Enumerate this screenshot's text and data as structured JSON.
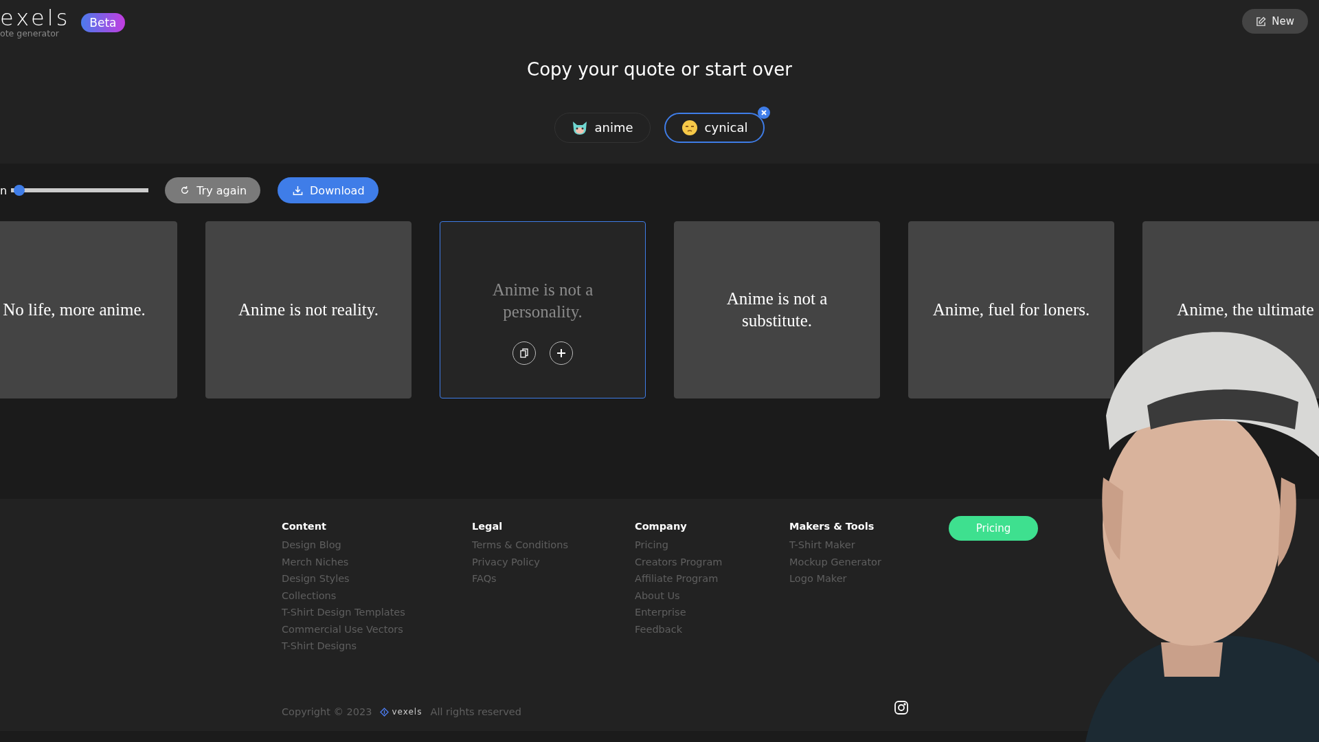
{
  "brand": {
    "logo": "exels",
    "tagline": "ote generator",
    "badge": "Beta"
  },
  "new_button": "New",
  "heading": "Copy your quote or start over",
  "tags": [
    {
      "label": "anime",
      "selected": false
    },
    {
      "label": "cynical",
      "selected": true
    }
  ],
  "slider": {
    "label": "n",
    "level": 0.02
  },
  "actions": [
    {
      "label": "Try again",
      "kind": "secondary"
    },
    {
      "label": "Download",
      "kind": "primary"
    }
  ],
  "quotes": [
    {
      "text": "No life, more anime.",
      "selected": false
    },
    {
      "text": "Anime is not reality.",
      "selected": false
    },
    {
      "text": "Anime is not a personality.",
      "selected": true
    },
    {
      "text": "Anime is not a substitute.",
      "selected": false
    },
    {
      "text": "Anime, fuel for loners.",
      "selected": false
    },
    {
      "text": "Anime, the ultimate",
      "selected": false
    }
  ],
  "footer": {
    "columns": [
      {
        "title": "Content",
        "links": [
          "Design Blog",
          "Merch Niches",
          "Design Styles",
          "Collections",
          "T-Shirt Design Templates",
          "Commercial Use Vectors",
          "T-Shirt Designs"
        ]
      },
      {
        "title": "Legal",
        "links": [
          "Terms & Conditions",
          "Privacy Policy",
          "FAQs"
        ]
      },
      {
        "title": "Company",
        "links": [
          "Pricing",
          "Creators Program",
          "Affiliate Program",
          "About Us",
          "Enterprise",
          "Feedback"
        ]
      },
      {
        "title": "Makers & Tools",
        "links": [
          "T-Shirt Maker",
          "Mockup Generator",
          "Logo Maker"
        ]
      }
    ],
    "pricing_button": "Pricing",
    "copyright": "Copyright © 2023",
    "brand": "vexels",
    "rights": "All rights reserved"
  }
}
